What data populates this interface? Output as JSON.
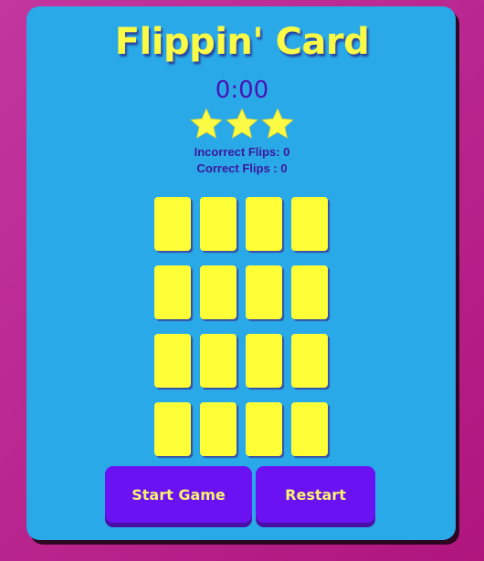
{
  "game": {
    "title": "Flippin' Card",
    "timer": "0:00",
    "star_rating": 3,
    "star_max": 3,
    "incorrect_label": "Incorrect Flips:",
    "incorrect_value": "0",
    "correct_label": "Correct Flips :",
    "correct_value": "0",
    "card_count": 16
  },
  "controls": {
    "start_label": "Start Game",
    "restart_label": "Restart"
  },
  "colors": {
    "background": "#b81e88",
    "panel": "#2aa9e8",
    "title": "#fbfb45",
    "timer": "#4a12b5",
    "card_back": "#ffff38",
    "button": "#6b12f2",
    "button_text": "#f8f36e",
    "star": "#fbfb45"
  },
  "icons": {
    "star": "star-icon"
  }
}
